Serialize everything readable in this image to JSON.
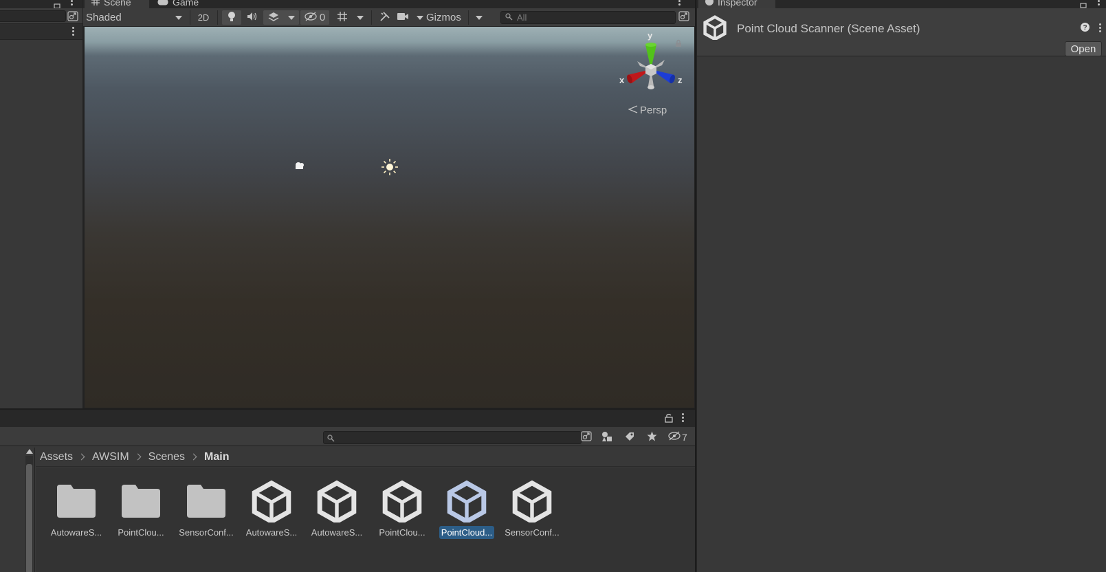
{
  "scene_panel": {
    "tabs": [
      {
        "label": "Scene",
        "icon": "grid-icon"
      },
      {
        "label": "Game",
        "icon": "gamepad-icon"
      }
    ],
    "toolbar": {
      "draw_mode": "Shaded",
      "mode_2d": "2D",
      "hidden_count": "0",
      "gizmos_label": "Gizmos",
      "search_placeholder": "All"
    },
    "orientation_gizmo": {
      "x_label": "x",
      "y_label": "y",
      "z_label": "z",
      "projection": "Persp"
    }
  },
  "inspector": {
    "tab_label": "Inspector",
    "title": "Point Cloud Scanner (Scene Asset)",
    "open_button": "Open"
  },
  "project": {
    "hidden_packages_count": "7",
    "breadcrumb": [
      "Assets",
      "AWSIM",
      "Scenes",
      "Main"
    ],
    "assets": [
      {
        "label": "AutowareS...",
        "type": "folder",
        "selected": false
      },
      {
        "label": "PointClou...",
        "type": "folder",
        "selected": false
      },
      {
        "label": "SensorConf...",
        "type": "folder",
        "selected": false
      },
      {
        "label": "AutowareS...",
        "type": "scene",
        "selected": false
      },
      {
        "label": "AutowareS...",
        "type": "scene",
        "selected": false
      },
      {
        "label": "PointClou...",
        "type": "scene",
        "selected": false
      },
      {
        "label": "PointCloud...",
        "type": "scene",
        "selected": true
      },
      {
        "label": "SensorConf...",
        "type": "scene",
        "selected": false
      }
    ]
  },
  "colors": {
    "selection": "#2c5d87",
    "gizmo_x": "#c0181a",
    "gizmo_y": "#52c21a",
    "gizmo_z": "#1d3dd6"
  }
}
